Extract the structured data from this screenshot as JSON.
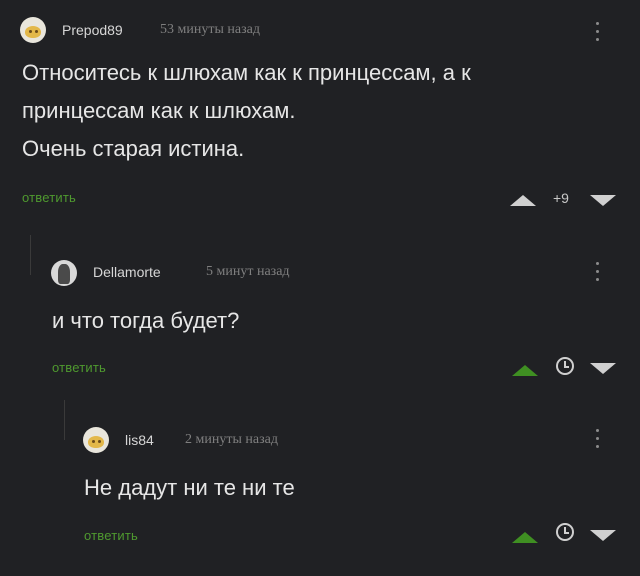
{
  "comments": [
    {
      "username": "Prepod89",
      "time": "53 минуты назад",
      "lines": [
        "Относитесь к шлюхам как к принцессам, а к",
        "принцессам как к шлюхам.",
        "Очень старая истина."
      ],
      "reply_label": "ответить",
      "score": "+9"
    },
    {
      "username": "Dellamorte",
      "time": "5 минут назад",
      "lines": [
        "и что тогда будет?"
      ],
      "reply_label": "ответить"
    },
    {
      "username": "lis84",
      "time": "2 минуты назад",
      "lines": [
        "Не дадут ни те ни те"
      ],
      "reply_label": "ответить"
    }
  ],
  "icons": {
    "menu": "more-vertical-icon",
    "upvote": "upvote-arrow-icon",
    "downvote": "downvote-arrow-icon",
    "clock": "clock-icon"
  },
  "colors": {
    "background": "#202124",
    "reply_link": "#4f9a2f",
    "upvoted": "#3f8f22"
  }
}
